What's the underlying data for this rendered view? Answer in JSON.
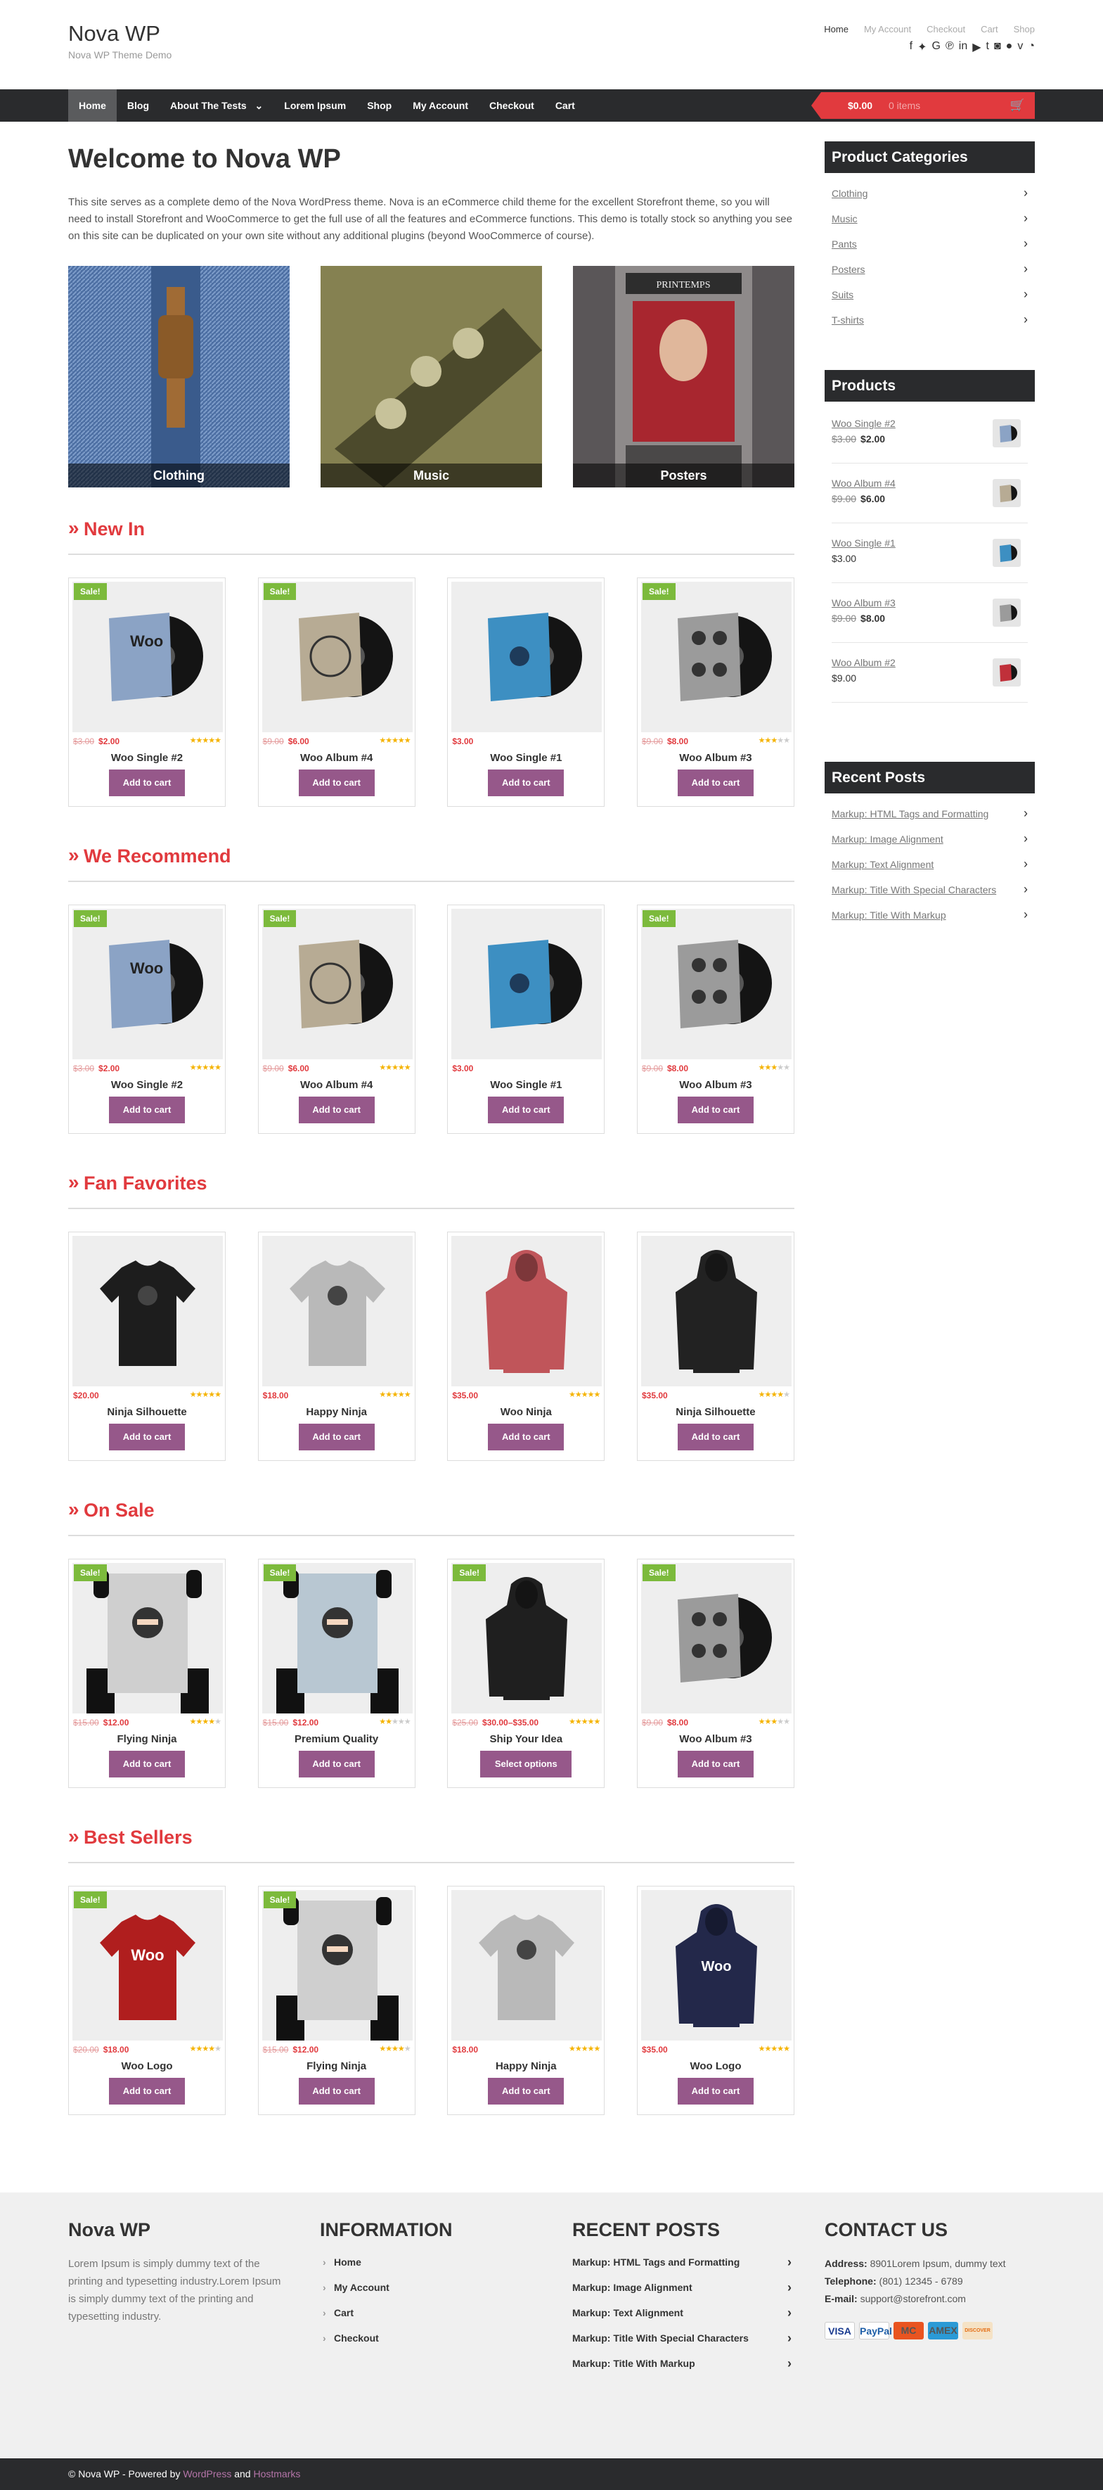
{
  "site": {
    "title": "Nova WP",
    "tagline": "Nova WP Theme Demo"
  },
  "toplinks": [
    "Home",
    "My Account",
    "Checkout",
    "Cart",
    "Shop"
  ],
  "social_icons": [
    "facebook-icon",
    "twitter-icon",
    "google-plus-icon",
    "pinterest-icon",
    "linkedin-icon",
    "youtube-icon",
    "tumblr-icon",
    "instagram-icon",
    "flickr-icon",
    "vimeo-icon",
    "rss-icon"
  ],
  "nav": {
    "items": [
      "Home",
      "Blog",
      "About The Tests",
      "Lorem Ipsum",
      "Shop",
      "My Account",
      "Checkout",
      "Cart"
    ],
    "dropdown_caret": "⌄"
  },
  "cart": {
    "amount": "$0.00",
    "items": "0 items"
  },
  "main": {
    "title": "Welcome to Nova WP",
    "intro": "This site serves as a complete demo of the Nova WordPress theme. Nova is an eCommerce child theme for the excellent Storefront theme, so you will need to install Storefront and WooCommerce to get the full use of all the features and eCommerce functions. This demo is totally stock so anything you see on this site can be duplicated on your own site without any additional plugins (beyond WooCommerce of course).",
    "categories": [
      "Clothing",
      "Music",
      "Posters"
    ]
  },
  "sections": [
    {
      "title": "New In",
      "products": [
        {
          "name": "Woo Single #2",
          "old": "$3.00",
          "price": "$2.00",
          "sale": "Sale!",
          "rating": 4.5,
          "kind": "album",
          "art": "woo"
        },
        {
          "name": "Woo Album #4",
          "old": "$9.00",
          "price": "$6.00",
          "sale": "Sale!",
          "rating": 5,
          "kind": "album",
          "art": "vintage"
        },
        {
          "name": "Woo Single #1",
          "old": "",
          "price": "$3.00",
          "sale": "",
          "rating": 0,
          "kind": "album",
          "art": "blue"
        },
        {
          "name": "Woo Album #3",
          "old": "$9.00",
          "price": "$8.00",
          "sale": "Sale!",
          "rating": 3,
          "kind": "album",
          "art": "ninja"
        }
      ]
    },
    {
      "title": "We Recommend",
      "products": [
        {
          "name": "Woo Single #2",
          "old": "$3.00",
          "price": "$2.00",
          "sale": "Sale!",
          "rating": 4.5,
          "kind": "album",
          "art": "woo"
        },
        {
          "name": "Woo Album #4",
          "old": "$9.00",
          "price": "$6.00",
          "sale": "Sale!",
          "rating": 5,
          "kind": "album",
          "art": "vintage"
        },
        {
          "name": "Woo Single #1",
          "old": "",
          "price": "$3.00",
          "sale": "",
          "rating": 0,
          "kind": "album",
          "art": "blue"
        },
        {
          "name": "Woo Album #3",
          "old": "$9.00",
          "price": "$8.00",
          "sale": "Sale!",
          "rating": 3,
          "kind": "album",
          "art": "ninja"
        }
      ]
    },
    {
      "title": "Fan Favorites",
      "products": [
        {
          "name": "Ninja Silhouette",
          "old": "",
          "price": "$20.00",
          "sale": "",
          "rating": 5,
          "kind": "tee",
          "color": "#1d1d1d"
        },
        {
          "name": "Happy Ninja",
          "old": "",
          "price": "$18.00",
          "sale": "",
          "rating": 5,
          "kind": "tee",
          "color": "#b9b9b9"
        },
        {
          "name": "Woo Ninja",
          "old": "",
          "price": "$35.00",
          "sale": "",
          "rating": 4.5,
          "kind": "hoodie",
          "color": "#c0555a"
        },
        {
          "name": "Ninja Silhouette",
          "old": "",
          "price": "$35.00",
          "sale": "",
          "rating": 4,
          "kind": "hoodie",
          "color": "#222"
        }
      ]
    },
    {
      "title": "On Sale",
      "products": [
        {
          "name": "Flying Ninja",
          "old": "$15.00",
          "price": "$12.00",
          "sale": "Sale!",
          "rating": 4,
          "kind": "poster",
          "color": "#cfcfcf"
        },
        {
          "name": "Premium Quality",
          "old": "$15.00",
          "price": "$12.00",
          "sale": "Sale!",
          "rating": 2,
          "kind": "poster",
          "color": "#b8c7d2"
        },
        {
          "name": "Ship Your Idea",
          "old": "$25.00",
          "price": "$30.00–$35.00",
          "sale": "Sale!",
          "rating": 4.5,
          "kind": "hoodie",
          "color": "#1f1f1f",
          "options": true
        },
        {
          "name": "Woo Album #3",
          "old": "$9.00",
          "price": "$8.00",
          "sale": "Sale!",
          "rating": 3,
          "kind": "album",
          "art": "ninja"
        }
      ]
    },
    {
      "title": "Best Sellers",
      "products": [
        {
          "name": "Woo Logo",
          "old": "$20.00",
          "price": "$18.00",
          "sale": "Sale!",
          "rating": 4,
          "kind": "tee",
          "color": "#b01e1e",
          "logo": "Woo"
        },
        {
          "name": "Flying Ninja",
          "old": "$15.00",
          "price": "$12.00",
          "sale": "Sale!",
          "rating": 4,
          "kind": "poster",
          "color": "#cfcfcf"
        },
        {
          "name": "Happy Ninja",
          "old": "",
          "price": "$18.00",
          "sale": "",
          "rating": 5,
          "kind": "tee",
          "color": "#b9b9b9"
        },
        {
          "name": "Woo Logo",
          "old": "",
          "price": "$35.00",
          "sale": "",
          "rating": 4.5,
          "kind": "hoodie",
          "color": "#23284a",
          "logo": "Woo"
        }
      ]
    }
  ],
  "buttons": {
    "add": "Add to cart",
    "options": "Select options"
  },
  "sidebar": {
    "cat_title": "Product Categories",
    "cats": [
      "Clothing",
      "Music",
      "Pants",
      "Posters",
      "Suits",
      "T-shirts"
    ],
    "prod_title": "Products",
    "prods": [
      {
        "name": "Woo Single #2",
        "old": "$3.00",
        "price": "$2.00"
      },
      {
        "name": "Woo Album #4",
        "old": "$9.00",
        "price": "$6.00"
      },
      {
        "name": "Woo Single #1",
        "old": "",
        "price": "$3.00"
      },
      {
        "name": "Woo Album #3",
        "old": "$9.00",
        "price": "$8.00"
      },
      {
        "name": "Woo Album #2",
        "old": "",
        "price": "$9.00"
      }
    ],
    "posts_title": "Recent Posts",
    "posts": [
      "Markup: HTML Tags and Formatting",
      "Markup: Image Alignment",
      "Markup: Text Alignment",
      "Markup: Title With Special Characters",
      "Markup: Title With Markup"
    ]
  },
  "footer": {
    "about_title": "Nova WP",
    "about_text": "Lorem Ipsum is simply dummy text of the printing and typesetting industry.Lorem Ipsum is simply dummy text of the printing and typesetting industry.",
    "info_title": "INFORMATION",
    "info": [
      "Home",
      "My Account",
      "Cart",
      "Checkout"
    ],
    "posts_title": "RECENT POSTS",
    "posts": [
      "Markup: HTML Tags and Formatting",
      "Markup: Image Alignment",
      "Markup: Text Alignment",
      "Markup: Title With Special Characters",
      "Markup: Title With Markup"
    ],
    "contact_title": "CONTACT US",
    "address_label": "Address:",
    "address": "8901Lorem Ipsum, dummy text",
    "phone_label": "Telephone:",
    "phone": "(801) 12345 - 6789",
    "email_label": "E-mail:",
    "email": "support@storefront.com",
    "cards": [
      "VISA",
      "PayPal",
      "MC",
      "AMEX",
      "DISCOVER"
    ]
  },
  "bottom": {
    "prefix": "© Nova WP - Powered by ",
    "wp": "WordPress",
    "and": " and ",
    "host": "Hostmarks"
  }
}
